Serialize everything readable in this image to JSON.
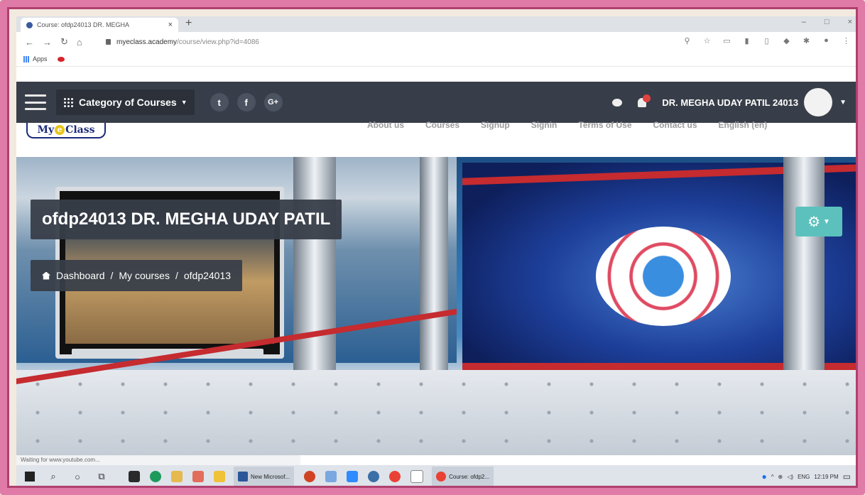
{
  "browser": {
    "tab_title": "Course: ofdp24013 DR. MEGHA",
    "tab_close": "×",
    "new_tab": "+",
    "url_domain": "myeclass.academy",
    "url_path": "/course/view.php?id=4086",
    "bookmarks_apps": "Apps",
    "window_controls": [
      "–",
      "□",
      "×"
    ]
  },
  "navbar": {
    "category_label": "Category of Courses",
    "social": [
      "t",
      "f",
      "G+"
    ],
    "user_name": "DR. MEGHA UDAY PATIL 24013"
  },
  "site": {
    "logo_pre": "My ",
    "logo_e": "e",
    "logo_post": "Class",
    "menu": [
      "About us",
      "Courses",
      "Signup",
      "Signin",
      "Terms of Use",
      "Contact us",
      "English (en)"
    ]
  },
  "hero": {
    "course_title": "ofdp24013 DR. MEGHA UDAY PATIL",
    "breadcrumb": [
      "Dashboard",
      "My courses",
      "ofdp24013"
    ],
    "breadcrumb_sep": "/"
  },
  "status_bar": "Waiting for www.youtube.com...",
  "taskbar": {
    "app1_label": "New Microsof...",
    "app2_label": "Course: ofdp2...",
    "lang": "ENG",
    "time": "12:19 PM"
  },
  "colors": {
    "navbar": "#383e49",
    "gear_button": "#5cc1bd",
    "frame": "#e07aa6"
  }
}
